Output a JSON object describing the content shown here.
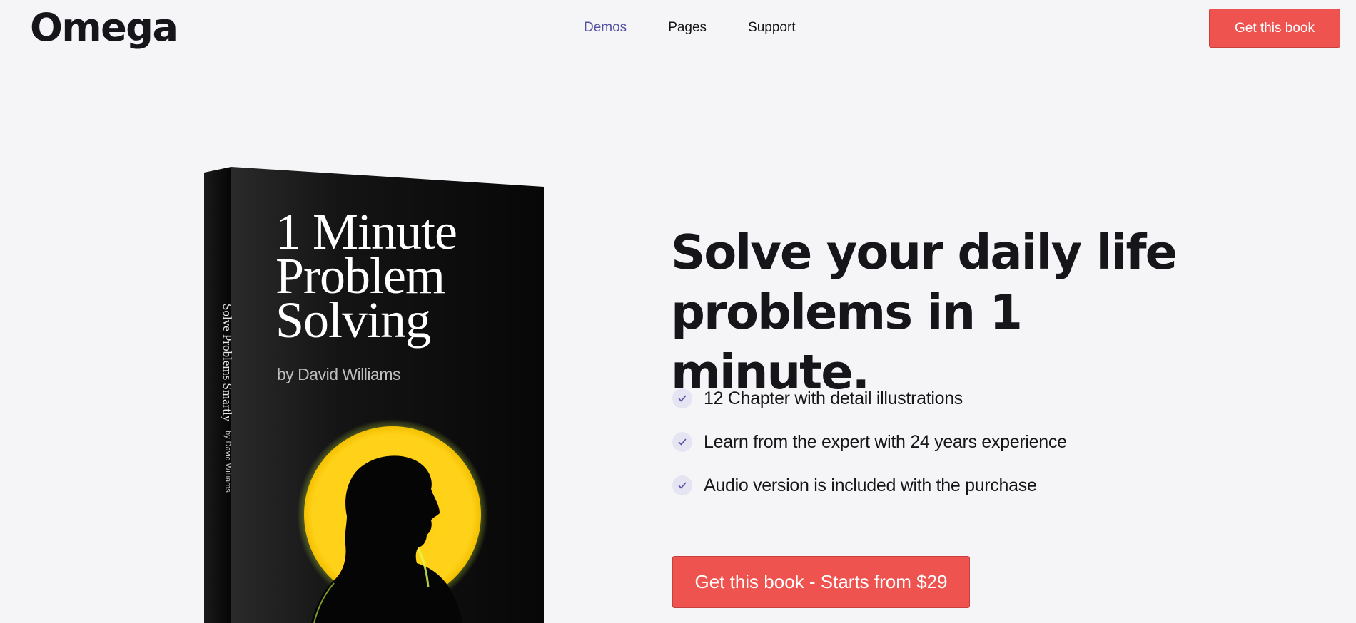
{
  "header": {
    "logo": "Omega",
    "nav": [
      {
        "label": "Demos",
        "active": true
      },
      {
        "label": "Pages",
        "active": false
      },
      {
        "label": "Support",
        "active": false
      }
    ],
    "cta_label": "Get this book"
  },
  "book": {
    "cover_title": "1 Minute\nProblem\nSolving",
    "cover_author": "by David Williams",
    "spine_title": "Solve Problems Smartly",
    "spine_author": "by David Williams"
  },
  "hero": {
    "headline": "Solve your daily life problems in 1 minute.",
    "features": [
      "12 Chapter with detail illustrations",
      "Learn from the expert with 24 years experience",
      "Audio version is included with the purchase"
    ],
    "cta_label": "Get this book - Starts from $29"
  },
  "colors": {
    "accent": "#ef5350",
    "nav_active": "#5552a4",
    "background": "#f5f5f8",
    "text": "#16161a",
    "check_bg": "#e4e4f2",
    "sun": "#ffd21a"
  },
  "icons": {
    "feature_bullet": "check-icon"
  }
}
